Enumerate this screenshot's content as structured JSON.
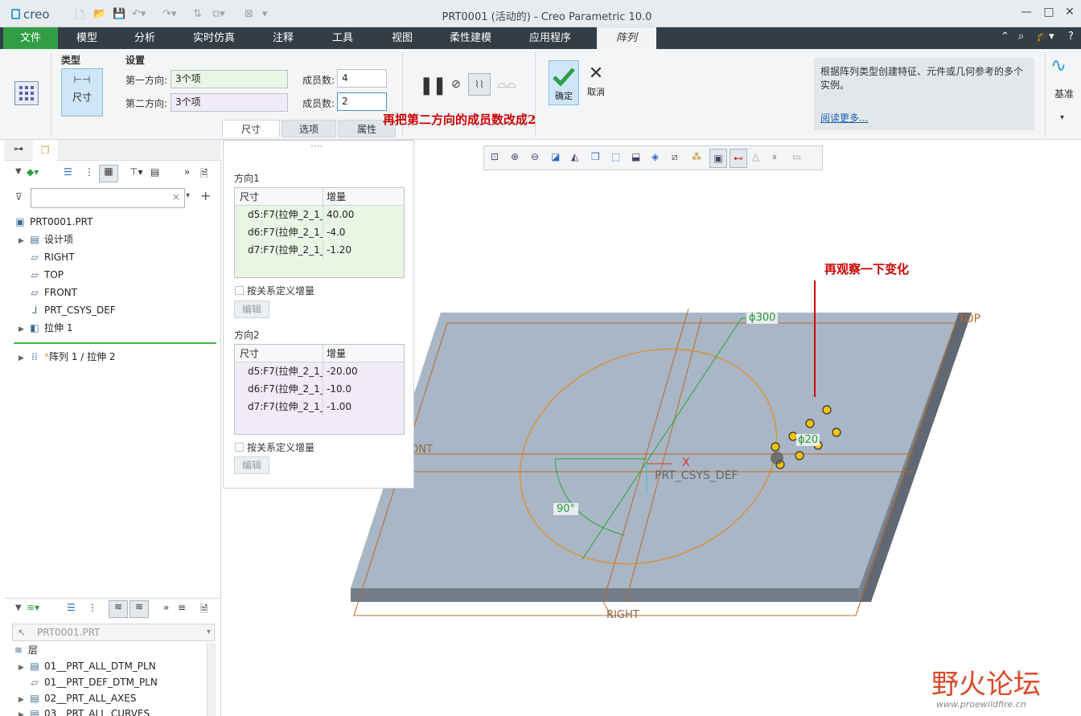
{
  "window": {
    "app_logo": "creo",
    "title": "PRT0001 (活动的) - Creo Parametric 10.0"
  },
  "ribbon_tabs": [
    "文件",
    "模型",
    "分析",
    "实时仿真",
    "注释",
    "工具",
    "视图",
    "柔性建模",
    "应用程序",
    "阵列"
  ],
  "ribbon": {
    "type_label": "类型",
    "type_value": "尺寸",
    "settings_label": "设置",
    "dir1_label": "第一方向:",
    "dir1_value": "3个项",
    "dir2_label": "第二方向:",
    "dir2_value": "3个项",
    "count1_label": "成员数:",
    "count1_value": "4",
    "count2_label": "成员数:",
    "count2_value": "2",
    "ok_label": "确定",
    "cancel_label": "取消",
    "subtabs": [
      "尺寸",
      "选项",
      "属性"
    ],
    "help_text": "根据阵列类型创建特征、元件或几何参考的多个实例。",
    "help_link": "阅读更多...",
    "datum_label": "基准"
  },
  "annotations": {
    "top": "再把第二方向的成员数改成2",
    "right": "再观察一下变化"
  },
  "model_tree": {
    "root": "PRT0001.PRT",
    "items": [
      "设计项",
      "RIGHT",
      "TOP",
      "FRONT",
      "PRT_CSYS_DEF",
      "拉伸 1"
    ],
    "pattern_item": "阵列 1 / 拉伸 2"
  },
  "flyout": {
    "dir1_title": "方向1",
    "dir2_title": "方向2",
    "col_dim": "尺寸",
    "col_inc": "增量",
    "dir1_rows": [
      [
        "d5:F7(拉伸_2_1_",
        "40.00"
      ],
      [
        "d6:F7(拉伸_2_1_",
        "-4.0"
      ],
      [
        "d7:F7(拉伸_2_1_",
        "-1.20"
      ]
    ],
    "dir2_rows": [
      [
        "d5:F7(拉伸_2_1_",
        "-20.00"
      ],
      [
        "d6:F7(拉伸_2_1_",
        "-10.0"
      ],
      [
        "d7:F7(拉伸_2_1_",
        "-1.00"
      ]
    ],
    "relation_label": "按关系定义增量",
    "edit_label": "编辑"
  },
  "layers": {
    "selector": "PRT0001.PRT",
    "root": "层",
    "items": [
      "01__PRT_ALL_DTM_PLN",
      "01__PRT_DEF_DTM_PLN",
      "02__PRT_ALL_AXES",
      "03__PRT_ALL_CURVES"
    ]
  },
  "viewport_labels": {
    "top_plane": "TOP",
    "right_plane": "RIGHT",
    "front_plane": "FRONT",
    "csys": "PRT_CSYS_DEF",
    "x_axis": "X",
    "dim_300": "ϕ300",
    "dim_20": "ϕ20",
    "angle": "90°"
  },
  "watermark": {
    "text": "野火论坛",
    "url": "www.proewildfire.cn"
  },
  "colors": {
    "file_tab": "#2f9e44",
    "annotation": "#cc0000",
    "plate": "#a9b6c6",
    "accent_green": "#22aa33"
  }
}
